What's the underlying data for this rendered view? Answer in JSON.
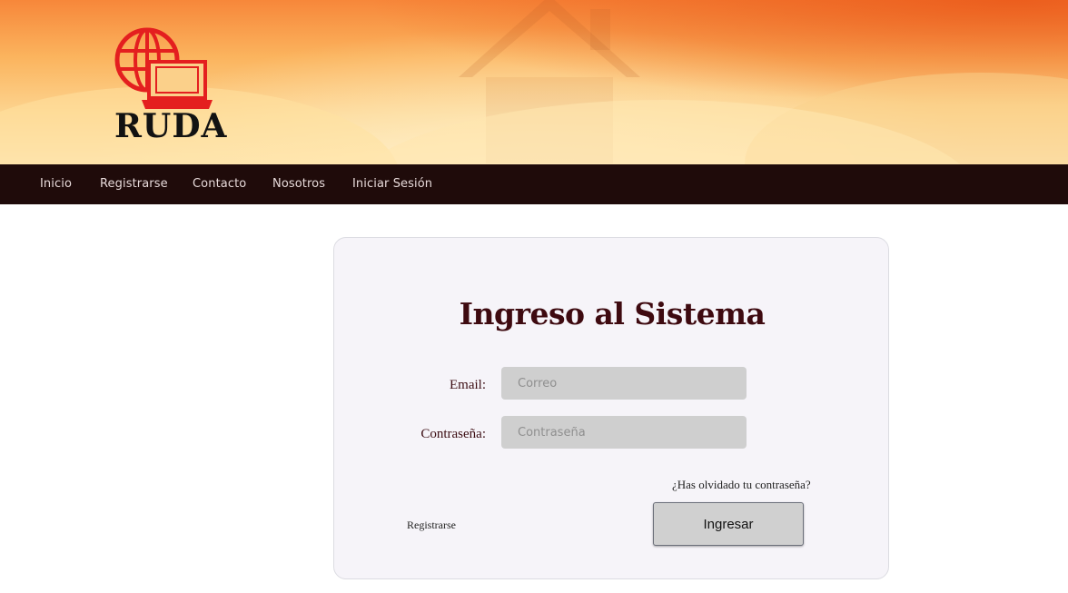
{
  "brand": {
    "name": "RUDA",
    "logo_icon": "globe-laptop-icon",
    "accent": "#e41f1f"
  },
  "nav": {
    "items": [
      {
        "label": "Inicio"
      },
      {
        "label": "Registrarse"
      },
      {
        "label": "Contacto"
      },
      {
        "label": "Nosotros"
      },
      {
        "label": "Iniciar Sesión"
      }
    ]
  },
  "login": {
    "title": "Ingreso al Sistema",
    "email_label": "Email:",
    "email_placeholder": "Correo",
    "password_label": "Contraseña:",
    "password_placeholder": "Contraseña",
    "forgot_label": "¿Has olvidado tu contraseña?",
    "register_label": "Registrarse",
    "submit_label": "Ingresar"
  },
  "colors": {
    "nav_bg": "#1f0b0a",
    "title": "#3e0a10",
    "card_bg": "#f6f4f9",
    "input_bg": "#cfcfcf"
  }
}
